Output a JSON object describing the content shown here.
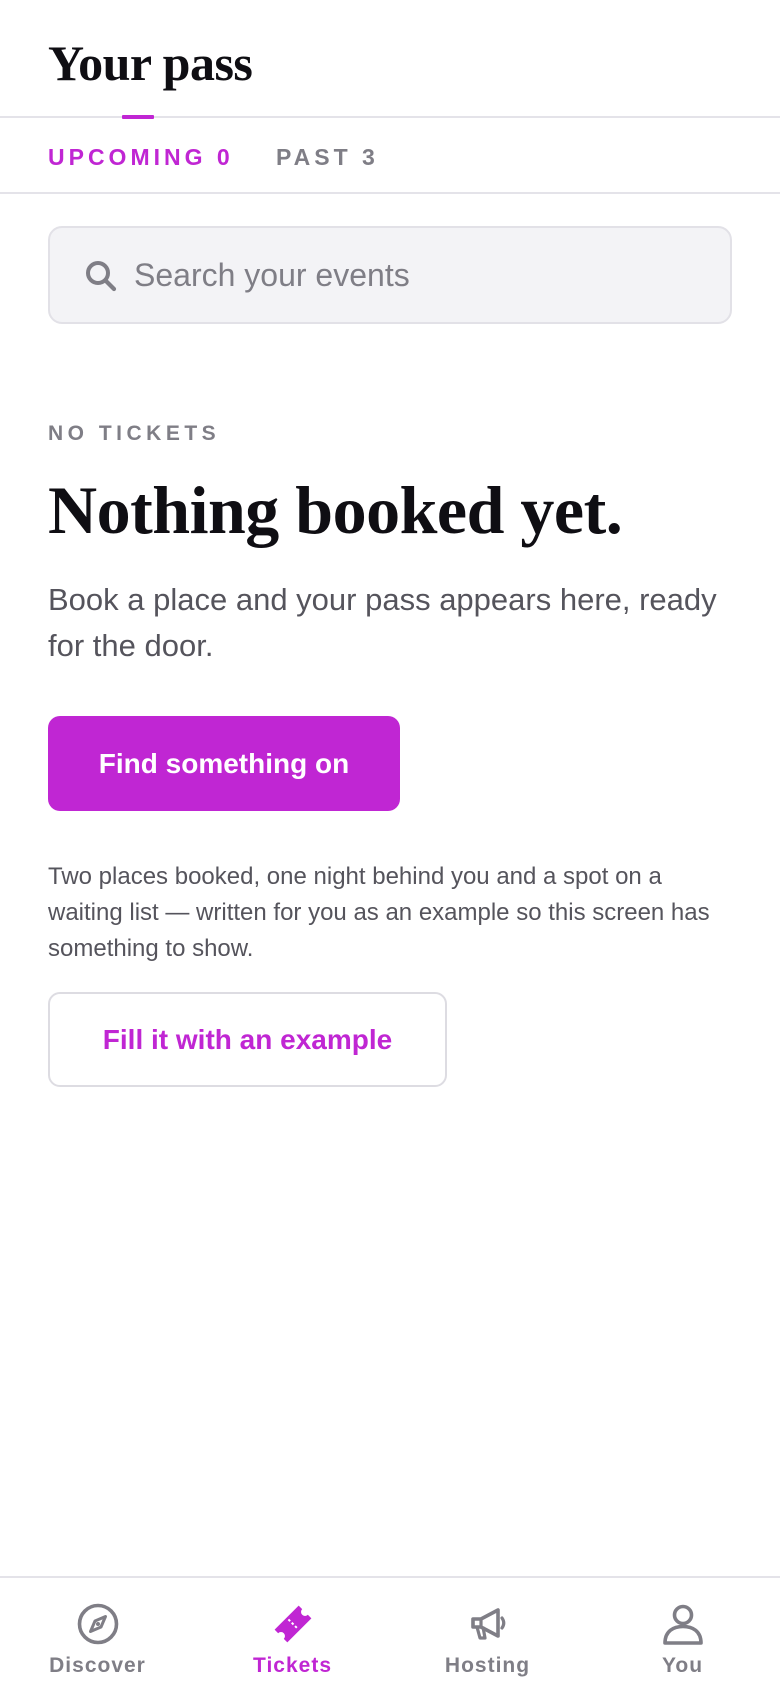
{
  "header": {
    "title": "Your pass"
  },
  "tabs": [
    {
      "label": "UPCOMING 0",
      "active": true
    },
    {
      "label": "PAST 3",
      "active": false
    }
  ],
  "search": {
    "placeholder": "Search your events",
    "icon": "search-icon"
  },
  "empty_state": {
    "eyebrow": "NO TICKETS",
    "headline": "Nothing booked yet.",
    "subtext": "Book a place and your pass appears here, ready for the door.",
    "primary_button": "Find something on",
    "note": "Two places booked, one night behind you and a spot on a waiting list — written for you as an example so this screen has something to show.",
    "secondary_button": "Fill it with an example"
  },
  "bottom_nav": [
    {
      "label": "Discover",
      "icon": "compass-icon",
      "active": false
    },
    {
      "label": "Tickets",
      "icon": "ticket-icon",
      "active": true
    },
    {
      "label": "Hosting",
      "icon": "megaphone-icon",
      "active": false
    },
    {
      "label": "You",
      "icon": "user-icon",
      "active": false
    }
  ],
  "colors": {
    "accent": "#c026d3",
    "text_primary": "#0f0e13",
    "text_secondary": "#55545c",
    "text_muted": "#7f7e86",
    "surface": "#f3f3f6",
    "border": "#e4e3e9"
  }
}
